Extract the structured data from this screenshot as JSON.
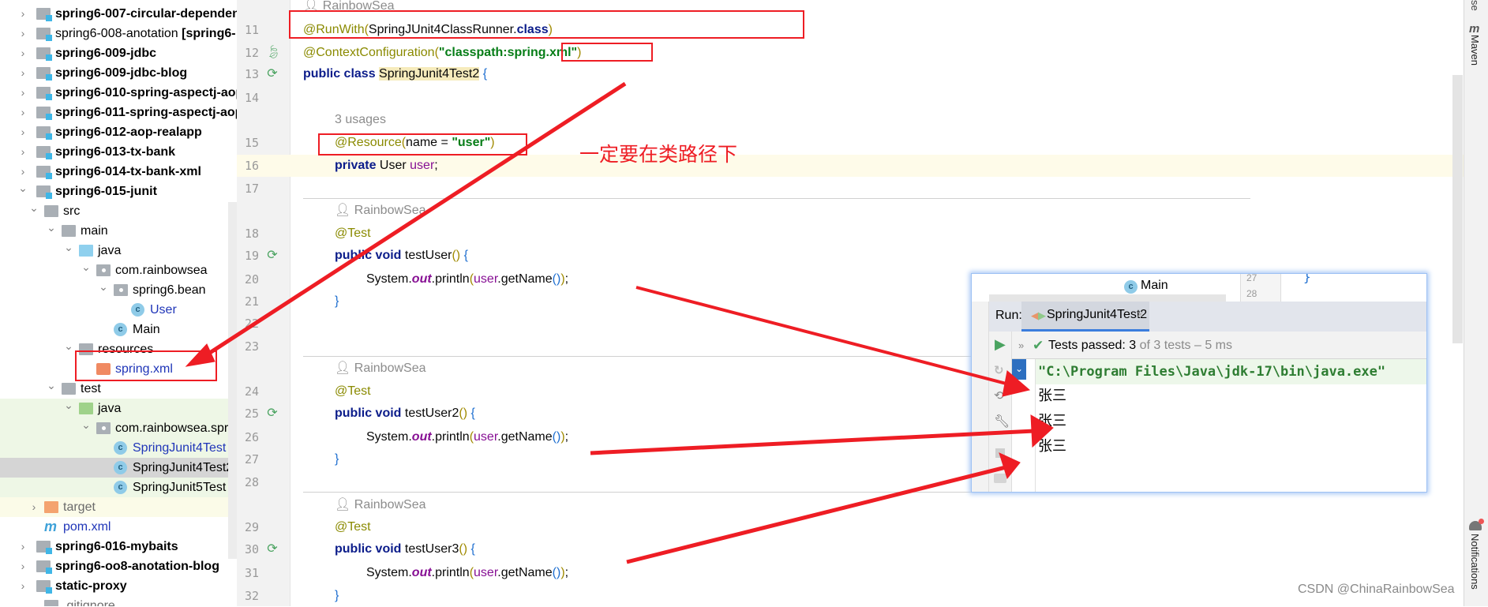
{
  "project_tree": [
    {
      "label": "spring6-007-circular-dependency",
      "level": 0,
      "arrow": "right",
      "icon": "module-folder",
      "bold": true
    },
    {
      "label": "spring6-008-anotation",
      "suffix": " [spring6-",
      "level": 0,
      "arrow": "right",
      "icon": "module-folder",
      "bold": false
    },
    {
      "label": "spring6-009-jdbc",
      "level": 0,
      "arrow": "right",
      "icon": "module-folder",
      "bold": true
    },
    {
      "label": "spring6-009-jdbc-blog",
      "level": 0,
      "arrow": "right",
      "icon": "module-folder",
      "bold": true
    },
    {
      "label": "spring6-010-spring-aspectj-aop",
      "level": 0,
      "arrow": "right",
      "icon": "module-folder",
      "bold": true
    },
    {
      "label": "spring6-011-spring-aspectj-aop",
      "level": 0,
      "arrow": "right",
      "icon": "module-folder",
      "bold": true
    },
    {
      "label": "spring6-012-aop-realapp",
      "level": 0,
      "arrow": "right",
      "icon": "module-folder",
      "bold": true
    },
    {
      "label": "spring6-013-tx-bank",
      "level": 0,
      "arrow": "right",
      "icon": "module-folder",
      "bold": true
    },
    {
      "label": "spring6-014-tx-bank-xml",
      "level": 0,
      "arrow": "right",
      "icon": "module-folder",
      "bold": true
    },
    {
      "label": "spring6-015-junit",
      "level": 0,
      "arrow": "down",
      "icon": "module-folder",
      "bold": true
    },
    {
      "label": "src",
      "level": 1,
      "arrow": "down",
      "icon": "folder"
    },
    {
      "label": "main",
      "level": 2,
      "arrow": "down",
      "icon": "folder"
    },
    {
      "label": "java",
      "level": 3,
      "arrow": "down",
      "icon": "source-folder"
    },
    {
      "label": "com.rainbowsea",
      "level": 4,
      "arrow": "down",
      "icon": "package"
    },
    {
      "label": "spring6.bean",
      "level": 5,
      "arrow": "down",
      "icon": "package"
    },
    {
      "label": "User",
      "level": 6,
      "icon": "class",
      "color": "blue"
    },
    {
      "label": "Main",
      "level": 5,
      "icon": "class-main"
    },
    {
      "label": "resources",
      "level": 3,
      "arrow": "down",
      "icon": "resources-folder"
    },
    {
      "label": "spring.xml",
      "level": 4,
      "icon": "spring-xml",
      "color": "blue"
    },
    {
      "label": "test",
      "level": 2,
      "arrow": "down",
      "icon": "folder"
    },
    {
      "label": "java",
      "level": 3,
      "arrow": "down",
      "icon": "test-folder",
      "bg": "green"
    },
    {
      "label": "com.rainbowsea.spring6.test",
      "level": 4,
      "arrow": "down",
      "icon": "package",
      "bg": "green"
    },
    {
      "label": "SpringJunit4Test",
      "level": 5,
      "icon": "test-class",
      "color": "blue",
      "bg": "green"
    },
    {
      "label": "SpringJunit4Test2",
      "level": 5,
      "icon": "test-class",
      "bg": "sel"
    },
    {
      "label": "SpringJunit5Test",
      "level": 5,
      "icon": "test-class",
      "bg": "green"
    },
    {
      "label": "target",
      "level": 1,
      "arrow": "right",
      "icon": "target-folder",
      "color": "gray",
      "bg": "yel"
    },
    {
      "label": "pom.xml",
      "level": 1,
      "icon": "maven",
      "color": "blue"
    },
    {
      "label": "spring6-016-mybaits",
      "level": 0,
      "arrow": "right",
      "icon": "module-folder",
      "bold": true
    },
    {
      "label": "spring6-oo8-anotation-blog",
      "level": 0,
      "arrow": "right",
      "icon": "module-folder",
      "bold": true
    },
    {
      "label": "static-proxy",
      "level": 0,
      "arrow": "right",
      "icon": "module-folder",
      "bold": true
    },
    {
      "label": ".gitignore",
      "level": 1,
      "icon": "file",
      "color": "gray"
    }
  ],
  "editor": {
    "author_hint": "RainbowSea",
    "usages_hint": "3 usages",
    "lines": [
      {
        "n": "11",
        "indent": 0,
        "tokens": [
          [
            "@RunWith",
            "ann"
          ],
          [
            "(",
            "p"
          ],
          [
            "SpringJUnit4ClassRunner.",
            ""
          ],
          [
            "class",
            "kw"
          ],
          [
            ")",
            "p"
          ]
        ],
        "gutter_icon": "fold"
      },
      {
        "n": "12",
        "indent": 0,
        "tokens": [
          [
            "@ContextConfiguration",
            "ann"
          ],
          [
            "(",
            "p"
          ],
          [
            "\"classpath:spring.xml\"",
            "str"
          ],
          [
            ")",
            "p"
          ]
        ],
        "gutter_icon": "spring-bean"
      },
      {
        "n": "13",
        "indent": 0,
        "tokens": [
          [
            "public class ",
            "kw"
          ],
          [
            "SpringJunit4Test2",
            "cls"
          ],
          [
            " ",
            ""
          ],
          [
            "{",
            "br"
          ]
        ],
        "gutter_icon": "run-test"
      },
      {
        "n": "14",
        "indent": 0,
        "tokens": []
      },
      {
        "n": "15",
        "indent": 1,
        "tokens": [
          [
            "@Resource",
            "ann"
          ],
          [
            "(",
            "p"
          ],
          [
            "name = ",
            ""
          ],
          [
            "\"user\"",
            "str"
          ],
          [
            ")",
            "p"
          ]
        ]
      },
      {
        "n": "16",
        "indent": 1,
        "tokens": [
          [
            "private ",
            "kw"
          ],
          [
            "User ",
            ""
          ],
          [
            "user",
            "fld"
          ],
          [
            ";",
            ""
          ]
        ]
      },
      {
        "n": "17",
        "indent": 0,
        "tokens": []
      },
      {
        "n": "18",
        "indent": 1,
        "tokens": [
          [
            "@Test",
            "ann"
          ]
        ]
      },
      {
        "n": "19",
        "indent": 1,
        "tokens": [
          [
            "public void ",
            "kw"
          ],
          [
            "testUser",
            ""
          ],
          [
            "()",
            "p"
          ],
          [
            " ",
            ""
          ],
          [
            "{",
            "br"
          ]
        ],
        "gutter_icon": "run-test"
      },
      {
        "n": "20",
        "indent": 2,
        "tokens": [
          [
            "System.",
            ""
          ],
          [
            "out",
            "it"
          ],
          [
            ".println",
            ""
          ],
          [
            "(",
            "p"
          ],
          [
            "user",
            "fld"
          ],
          [
            ".getName",
            ""
          ],
          [
            "()",
            "br"
          ],
          [
            ")",
            "p"
          ],
          [
            ";",
            ""
          ]
        ]
      },
      {
        "n": "21",
        "indent": 1,
        "tokens": [
          [
            "}",
            "br"
          ]
        ]
      },
      {
        "n": "22",
        "indent": 0,
        "tokens": []
      },
      {
        "n": "23",
        "indent": 0,
        "tokens": []
      },
      {
        "n": "24",
        "indent": 1,
        "tokens": [
          [
            "@Test",
            "ann"
          ]
        ]
      },
      {
        "n": "25",
        "indent": 1,
        "tokens": [
          [
            "public void ",
            "kw"
          ],
          [
            "testUser2",
            ""
          ],
          [
            "()",
            "p"
          ],
          [
            " ",
            ""
          ],
          [
            "{",
            "br"
          ]
        ],
        "gutter_icon": "run-test"
      },
      {
        "n": "26",
        "indent": 2,
        "tokens": [
          [
            "System.",
            ""
          ],
          [
            "out",
            "it"
          ],
          [
            ".println",
            ""
          ],
          [
            "(",
            "p"
          ],
          [
            "user",
            "fld"
          ],
          [
            ".getName",
            ""
          ],
          [
            "()",
            "br"
          ],
          [
            ")",
            "p"
          ],
          [
            ";",
            ""
          ]
        ]
      },
      {
        "n": "27",
        "indent": 1,
        "tokens": [
          [
            "}",
            "br"
          ]
        ]
      },
      {
        "n": "28",
        "indent": 0,
        "tokens": []
      },
      {
        "n": "29",
        "indent": 1,
        "tokens": [
          [
            "@Test",
            "ann"
          ]
        ]
      },
      {
        "n": "30",
        "indent": 1,
        "tokens": [
          [
            "public void ",
            "kw"
          ],
          [
            "testUser3",
            ""
          ],
          [
            "()",
            "p"
          ],
          [
            " ",
            ""
          ],
          [
            "{",
            "br"
          ]
        ],
        "gutter_icon": "run-test"
      },
      {
        "n": "31",
        "indent": 2,
        "tokens": [
          [
            "System.",
            ""
          ],
          [
            "out",
            "it"
          ],
          [
            ".println",
            ""
          ],
          [
            "(",
            "p"
          ],
          [
            "user",
            "fld"
          ],
          [
            ".getName",
            ""
          ],
          [
            "()",
            "br"
          ],
          [
            ")",
            "p"
          ],
          [
            ";",
            ""
          ]
        ]
      },
      {
        "n": "32",
        "indent": 1,
        "tokens": [
          [
            "}",
            "br"
          ]
        ]
      }
    ]
  },
  "right_toolbar": {
    "maven": "Maven",
    "notifications": "Notifications",
    "partial_top": "se"
  },
  "run_panel": {
    "background_file": "Main",
    "background_lines": [
      "27",
      "28"
    ],
    "background_brace": "}",
    "run_label": "Run:",
    "tab_label": "SpringJunit4Test2",
    "status_prefix": "Tests passed: 3",
    "status_suffix": " of 3 tests – 5 ms",
    "command": "\"C:\\Program Files\\Java\\jdk-17\\bin\\java.exe\"",
    "output": [
      "张三",
      "张三",
      "张三"
    ]
  },
  "annotation": {
    "note": "一定要在类路径下",
    "color": "#ee1d24"
  },
  "watermark": "CSDN @ChinaRainbowSea"
}
